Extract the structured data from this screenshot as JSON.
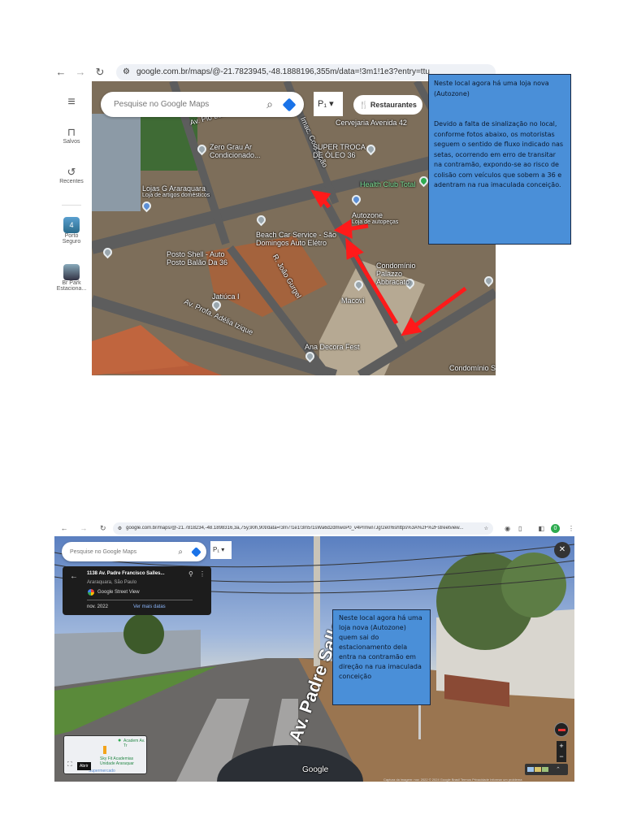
{
  "screenshot1": {
    "browser": {
      "url": "google.com.br/maps/@-21.7823945,-48.1888196,355m/data=!3m1!1e3?entry=ttu",
      "back": "←",
      "forward": "→",
      "reload": "↻"
    },
    "sidebar": {
      "menu": "≡",
      "items": [
        {
          "label": "Salvos",
          "icon": "bookmark-icon"
        },
        {
          "label": "Recentes",
          "icon": "history-icon"
        },
        {
          "label": "Porto Seguro",
          "badge": "4"
        },
        {
          "label": "Br Park Estaciona..."
        }
      ]
    },
    "search": {
      "placeholder": "Pesquise no Google Maps"
    },
    "chip_restaurants": "Restaurantes",
    "layer_toggle": "P₁",
    "map_labels": [
      "Av. Pio Lo...",
      "Imac. Conceição",
      "Cervejaria Avenida 42",
      "Zero Grau Ar Condicionado...",
      "SUPER TROCA DE ÓLEO 36",
      "Lojas G Araraquara",
      "Loja de artigos domésticos",
      "Health Club Total",
      "Autozone",
      "Loja de autopeças",
      "Beach Car Service - São Domingos Auto Elétro",
      "Posto Shell - Auto Posto Balão Da 36",
      "Condomínio Palazzo Abbracato",
      "Jatiúca I",
      "Macovi",
      "R. João Gurgel",
      "Av. Profa. Adélia Izique",
      "Ana Decora Fest",
      "Condomínio S"
    ],
    "callout": {
      "line1": "Neste local agora há uma loja nova (Autozone)",
      "line2": "Devido a falta de sinalização no local, conforme fotos abaixo, os motoristas seguem o sentido de fluxo indicado nas setas, ocorrendo em erro de transitar na contramão, expondo-se ao risco de colisão com veículos que sobem a 36 e adentram na rua imaculada conceição."
    },
    "colors": {
      "callout": "#4a8fd8",
      "arrow": "#ff1a1a"
    }
  },
  "screenshot2": {
    "browser": {
      "url": "google.com.br/maps/@-21.7818234,-48.1898316,3a,75y,90h,90t/data=!3m7!1e1!3m5!1sWa6d2dmwoP0_v4Prmwl7Jg!2e0!6shttps%3A%2F%2Fstreetview...",
      "avatar": "0"
    },
    "search": {
      "placeholder": "Pesquise no Google Maps"
    },
    "layer_toggle": "P₁",
    "place": {
      "title": "1138 Av. Padre Francisco Salles...",
      "subtitle": "Araraquara, São Paulo",
      "source": "Google Street View",
      "date": "nov. 2022",
      "more_dates": "Ver mais datas"
    },
    "street_label": "Av. Padre Salles",
    "callout": "Neste local agora há uma loja nova (Autozone) quem sai do estacionamento dela entra na contramão em direção  na rua imaculada conceição",
    "minimap": {
      "labels": [
        "Academ Av. Tr",
        "Sky Fit Academias Unidade Araraquar",
        "Supermercado"
      ],
      "open": "Abrir"
    },
    "google": "Google",
    "footer": "Captura da imagem: nov. 2022   © 2024 Google   Brasil   Termos   Privacidade   Informar um problema",
    "zoom_in": "+",
    "zoom_out": "−",
    "close": "✕"
  }
}
